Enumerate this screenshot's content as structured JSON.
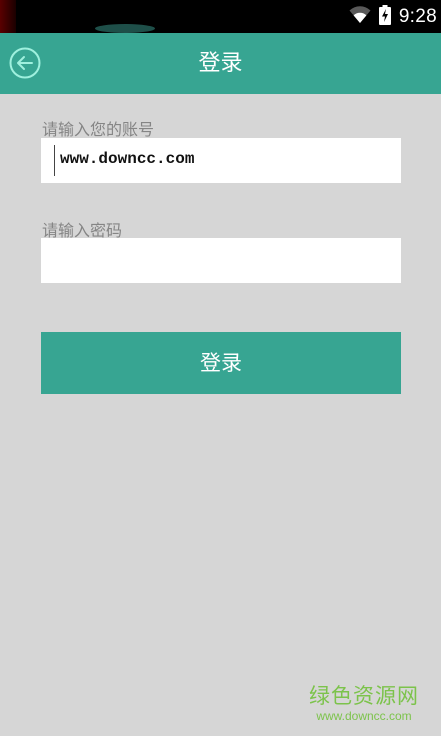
{
  "status_bar": {
    "time": "9:28",
    "icons": [
      "wifi-icon",
      "battery-charging-icon"
    ]
  },
  "app_bar": {
    "title": "登录",
    "back_icon": "back-arrow-circle-icon"
  },
  "form": {
    "account_label": "请输入您的账号",
    "account_value": "www.downcc.com",
    "password_label": "请输入密码",
    "password_value": ""
  },
  "login_button": {
    "label": "登录"
  },
  "watermark": {
    "name": "绿色资源网",
    "url": "www.downcc.com"
  },
  "colors": {
    "accent": "#37a592",
    "background": "#d6d6d6",
    "label": "#858585",
    "watermark": "#7cc34b"
  }
}
